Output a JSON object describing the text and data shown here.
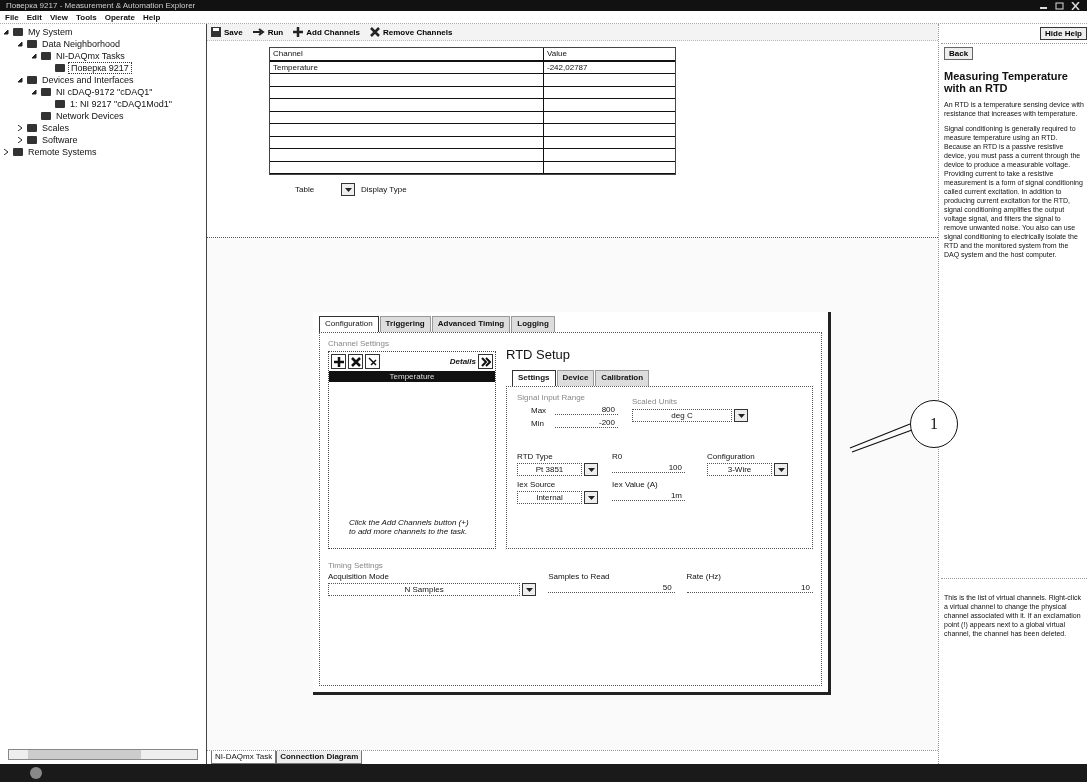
{
  "window": {
    "title": "Поверка 9217 - Measurement & Automation Explorer"
  },
  "menu": [
    "File",
    "Edit",
    "View",
    "Tools",
    "Operate",
    "Help"
  ],
  "tree": [
    {
      "label": "My System",
      "expanded": true,
      "selected": false,
      "children": [
        {
          "label": "Data Neighborhood",
          "expanded": true,
          "selected": false,
          "children": [
            {
              "label": "NI-DAQmx Tasks",
              "expanded": true,
              "selected": false,
              "children": [
                {
                  "label": "Поверка 9217",
                  "selected": true
                }
              ]
            }
          ]
        },
        {
          "label": "Devices and Interfaces",
          "expanded": true,
          "selected": false,
          "children": [
            {
              "label": "NI cDAQ-9172 \"cDAQ1\"",
              "expanded": true,
              "selected": false,
              "children": [
                {
                  "label": "1: NI 9217 \"cDAQ1Mod1\"",
                  "selected": false
                }
              ]
            },
            {
              "label": "Network Devices",
              "selected": false
            }
          ]
        },
        {
          "label": "Scales",
          "expanded": false,
          "selected": false
        },
        {
          "label": "Software",
          "expanded": false,
          "selected": false
        }
      ]
    },
    {
      "label": "Remote Systems",
      "expanded": false,
      "selected": false
    }
  ],
  "toolbar": [
    {
      "kind": "save",
      "label": "Save"
    },
    {
      "kind": "run",
      "label": "Run"
    },
    {
      "kind": "add",
      "label": "Add Channels"
    },
    {
      "kind": "remove",
      "label": "Remove Channels"
    }
  ],
  "hide_help": "Hide Help",
  "table": {
    "columns": [
      "Channel",
      "Value"
    ],
    "rows": [
      [
        "Temperature",
        "-242,02787"
      ]
    ]
  },
  "display": {
    "value": "Table",
    "label": "Display Type"
  },
  "dialog": {
    "tabs": [
      {
        "label": "Configuration",
        "selected": true
      },
      {
        "label": "Triggering",
        "selected": false
      },
      {
        "label": "Advanced Timing",
        "selected": false
      },
      {
        "label": "Logging",
        "selected": false
      }
    ],
    "channel_settings": {
      "title": "Channel Settings",
      "details": "Details",
      "channels": [
        {
          "name": "Temperature",
          "selected": true
        }
      ],
      "hint": "Click the Add Channels button (+) to add more channels to the task."
    },
    "rtd": {
      "title": "RTD Setup",
      "tabs": [
        {
          "label": "Settings",
          "selected": true
        },
        {
          "label": "Device",
          "selected": false
        },
        {
          "label": "Calibration",
          "selected": false
        }
      ],
      "range": {
        "title": "Signal Input Range",
        "max_label": "Max",
        "max": "800",
        "min_label": "Min",
        "min": "-200"
      },
      "units": {
        "title": "Scaled Units",
        "value": "deg C"
      },
      "fields": [
        {
          "label": "RTD Type",
          "value": "Pt 3851",
          "kind": "dropdown"
        },
        {
          "label": "R0",
          "value": "100",
          "kind": "text"
        },
        {
          "label": "Configuration",
          "value": "3-Wire",
          "kind": "dropdown"
        },
        {
          "label": "Iex Source",
          "value": "Internal",
          "kind": "dropdown"
        },
        {
          "label": "Iex Value (A)",
          "value": "1m",
          "kind": "text"
        }
      ]
    },
    "timing": {
      "title": "Timing Settings",
      "fields": [
        {
          "label": "Acquisition Mode",
          "value": "N Samples",
          "kind": "dropdown"
        },
        {
          "label": "Samples to Read",
          "value": "50",
          "kind": "text"
        },
        {
          "label": "Rate (Hz)",
          "value": "10",
          "kind": "text"
        }
      ]
    }
  },
  "help": {
    "back": "Back",
    "title": "Measuring Temperature with an RTD",
    "paragraphs": [
      "An RTD is a temperature sensing device with resistance that increases with temperature.",
      "Signal conditioning is generally required to measure temperature using an RTD. Because an RTD is a passive resistive device, you must pass a current through the device to produce a measurable voltage. Providing current to take a resistive measurement is a form of signal conditioning called current excitation. In addition to producing current excitation for the RTD, signal conditioning amplifies the output voltage signal, and filters the signal to remove unwanted noise. You also can use signal conditioning to electrically isolate the RTD and the monitored system from the DAQ system and the host computer."
    ],
    "lower": "This is the list of virtual channels. Right-click a virtual channel to change the physical channel associated with it. If an exclamation point (!) appears next to a global virtual channel, the channel has been deleted."
  },
  "callout": "1",
  "bottom_tabs": [
    {
      "label": "NI-DAQmx Task",
      "selected": true
    },
    {
      "label": "Connection Diagram",
      "selected": false
    }
  ]
}
